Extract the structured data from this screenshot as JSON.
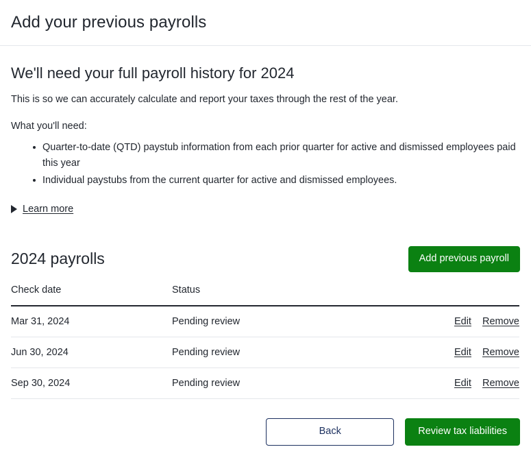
{
  "topbar": {
    "title": "Add your previous payrolls"
  },
  "intro": {
    "heading": "We'll need your full payroll history for 2024",
    "lead": "This is so we can accurately calculate and report your taxes through the rest of the year.",
    "needs_label": "What you'll need:",
    "needs_items": [
      "Quarter-to-date (QTD) paystub information from each prior quarter for active and dismissed employees paid this year",
      "Individual paystubs from the current quarter for active and dismissed employees."
    ],
    "learn_more_label": "Learn more",
    "learn_more_icon": "disclosure-triangle-collapsed-icon"
  },
  "payrolls": {
    "title": "2024 payrolls",
    "add_button_label": "Add previous payroll",
    "columns": [
      "Check date",
      "Status",
      ""
    ],
    "rows": [
      {
        "check_date": "Mar 31, 2024",
        "status": "Pending review",
        "edit_label": "Edit",
        "remove_label": "Remove"
      },
      {
        "check_date": "Jun 30, 2024",
        "status": "Pending review",
        "edit_label": "Edit",
        "remove_label": "Remove"
      },
      {
        "check_date": "Sep 30, 2024",
        "status": "Pending review",
        "edit_label": "Edit",
        "remove_label": "Remove"
      }
    ]
  },
  "footer": {
    "back_label": "Back",
    "primary_label": "Review tax liabilities"
  },
  "colors": {
    "green": "#0b8112",
    "navy": "#1b2f5e",
    "text": "#22272f",
    "divider": "#e4e7eb"
  }
}
